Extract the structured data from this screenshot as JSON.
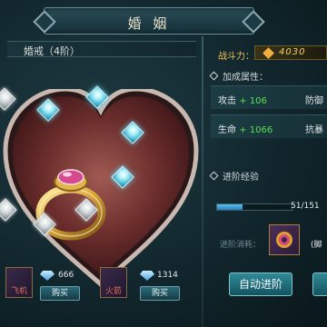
{
  "window": {
    "title": "婚 姻"
  },
  "ring": {
    "name": "婚戒（4阶）"
  },
  "items": [
    {
      "label": "飞机",
      "count": "666",
      "buy_label": "购买"
    },
    {
      "label": "火箭",
      "count": "1314",
      "buy_label": "购买"
    }
  ],
  "power": {
    "label": "战斗力：",
    "value": "4030"
  },
  "attributes": {
    "heading": "加成属性：",
    "rows": [
      {
        "left_name": "攻击",
        "left_value": "+ 106",
        "right_name": "防御"
      },
      {
        "left_name": "生命",
        "left_value": "+ 1066",
        "right_name": "抗暴"
      }
    ]
  },
  "advance": {
    "heading": "进阶经验",
    "progress_text": "51/151",
    "progress_fraction": 0.34,
    "material_label": "进阶消耗：",
    "material_count": "(脚",
    "auto_button": "自动进阶"
  },
  "colors": {
    "accent": "#59e04f",
    "gold": "#f1c14f",
    "gem": "#5fd7f0"
  }
}
